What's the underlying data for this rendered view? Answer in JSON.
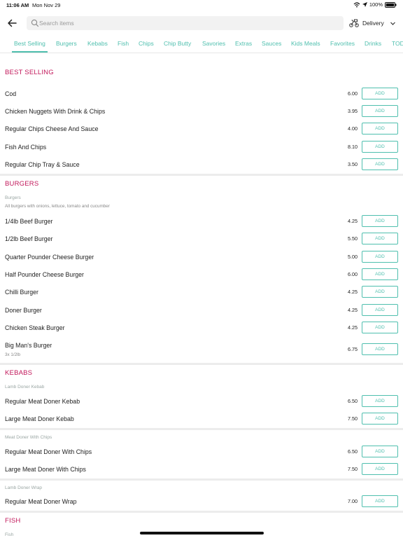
{
  "status_bar": {
    "time": "11:06 AM",
    "date": "Mon Nov 29",
    "battery": "100%"
  },
  "header": {
    "search_placeholder": "Search items",
    "delivery_label": "Delivery"
  },
  "tabs": [
    {
      "label": "Best Selling"
    },
    {
      "label": "Burgers"
    },
    {
      "label": "Kebabs"
    },
    {
      "label": "Fish"
    },
    {
      "label": "Chips"
    },
    {
      "label": "Chip Butty"
    },
    {
      "label": "Savories"
    },
    {
      "label": "Extras"
    },
    {
      "label": "Sauces"
    },
    {
      "label": "Kids Meals"
    },
    {
      "label": "Favorites"
    },
    {
      "label": "Drinks"
    },
    {
      "label": "TOD"
    }
  ],
  "add_label": "ADD",
  "sections": {
    "best_selling": {
      "title": "BEST SELLING",
      "items": [
        {
          "name": "Cod",
          "price": "6.00"
        },
        {
          "name": "Chicken Nuggets With Drink & Chips",
          "price": "3.95"
        },
        {
          "name": "Regular Chips Cheese And Sauce",
          "price": "4.00"
        },
        {
          "name": "Fish And Chips",
          "price": "8.10"
        },
        {
          "name": "Regular Chip Tray & Sauce",
          "price": "3.50"
        }
      ]
    },
    "burgers": {
      "title": "BURGERS",
      "group_label": "Burgers",
      "group_desc": "All burgers with onions, lettuce, tomato and cucumber",
      "items": [
        {
          "name": "1/4lb Beef Burger",
          "price": "4.25"
        },
        {
          "name": "1/2lb Beef Burger",
          "price": "5.50"
        },
        {
          "name": "Quarter Pounder Cheese Burger",
          "price": "5.00"
        },
        {
          "name": "Half Pounder Cheese Burger",
          "price": "6.00"
        },
        {
          "name": "Chilli Burger",
          "price": "4.25"
        },
        {
          "name": "Doner Burger",
          "price": "4.25"
        },
        {
          "name": "Chicken Steak Burger",
          "price": "4.25"
        },
        {
          "name": "Big Man's Burger",
          "price": "6.75",
          "sub": "3x 1/2lb"
        }
      ]
    },
    "kebabs": {
      "title": "KEBABS",
      "groups": [
        {
          "label": "Lamb Doner Kebab",
          "items": [
            {
              "name": "Regular Meat Doner Kebab",
              "price": "6.50"
            },
            {
              "name": "Large Meat Doner Kebab",
              "price": "7.50"
            }
          ]
        },
        {
          "label": "Meat Doner With Chips",
          "items": [
            {
              "name": "Regular Meat Doner With Chips",
              "price": "6.50"
            },
            {
              "name": "Large Meat Doner With Chips",
              "price": "7.50"
            }
          ]
        },
        {
          "label": "Lamb Doner Wrap",
          "items": [
            {
              "name": "Regular Meat Doner Wrap",
              "price": "7.00"
            }
          ]
        }
      ]
    },
    "fish": {
      "title": "FISH",
      "group_label": "Fish"
    }
  },
  "colors": {
    "accent": "#4fbfae",
    "section_title": "#c2185b"
  }
}
